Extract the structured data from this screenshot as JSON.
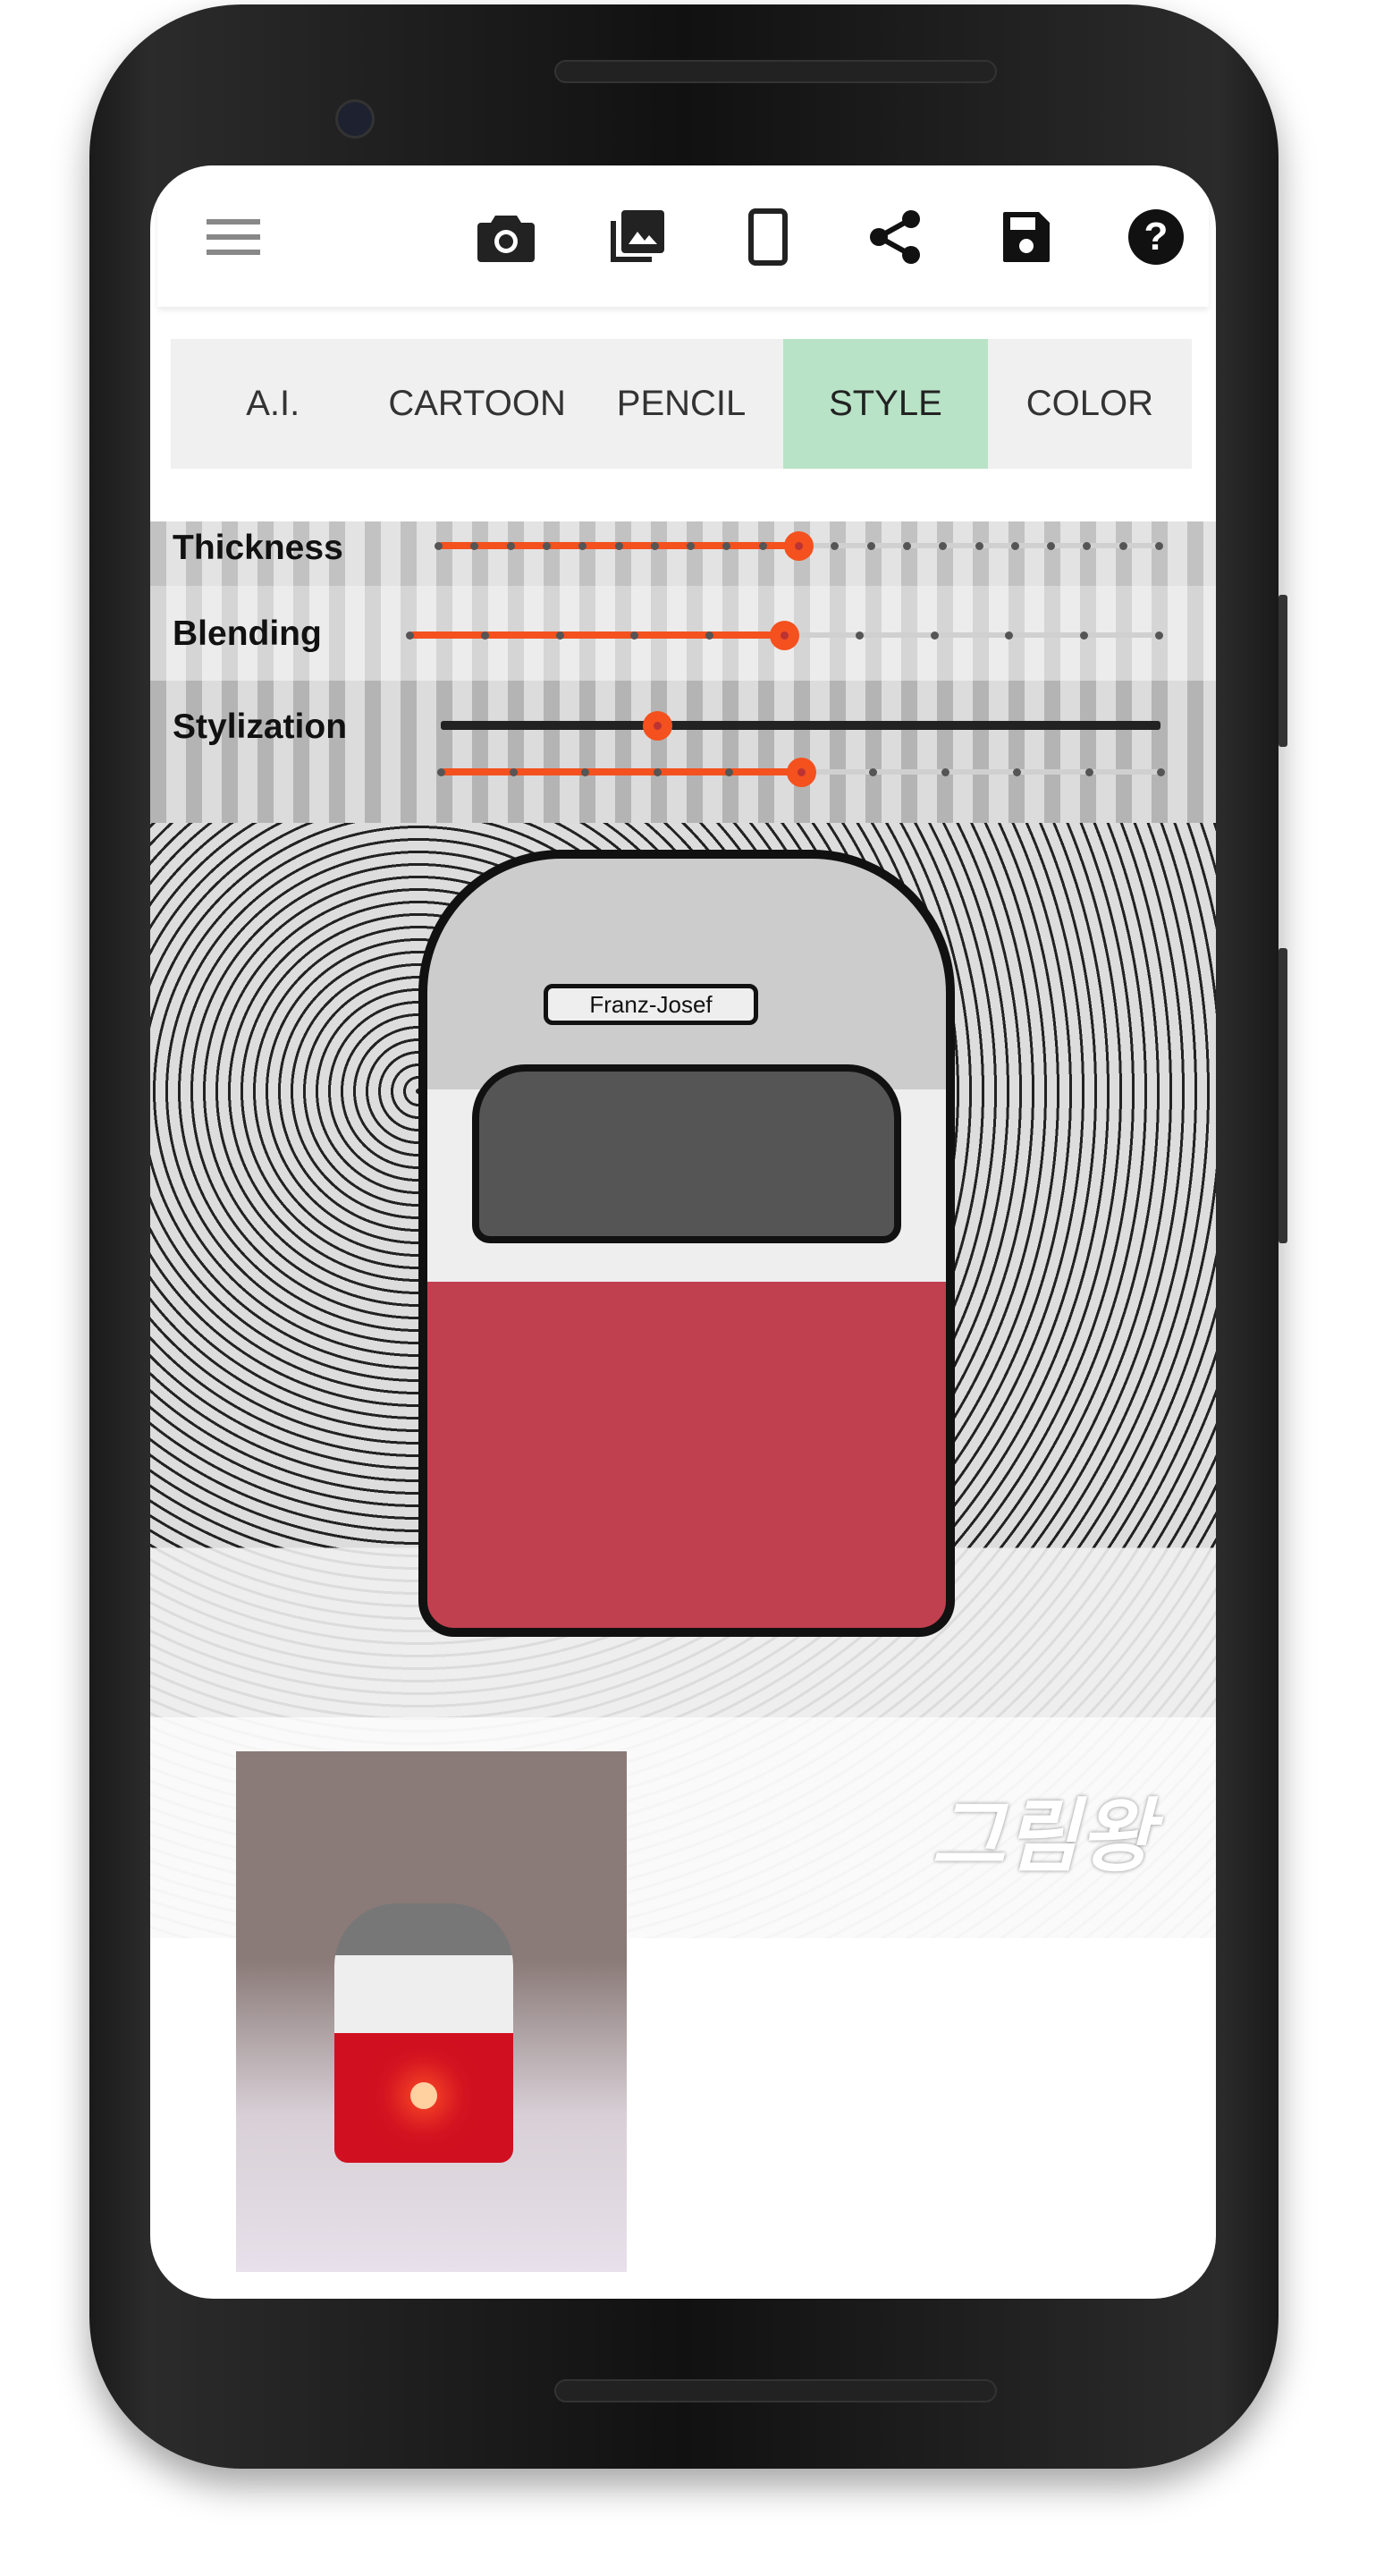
{
  "toolbar": {
    "icons": [
      "menu-icon",
      "camera-icon",
      "gallery-icon",
      "phone-portrait-icon",
      "share-icon",
      "save-icon",
      "help-icon"
    ]
  },
  "tabs": [
    {
      "label": "A.I.",
      "active": false
    },
    {
      "label": "CARTOON",
      "active": false
    },
    {
      "label": "PENCIL",
      "active": false
    },
    {
      "label": "STYLE",
      "active": true
    },
    {
      "label": "COLOR",
      "active": false
    }
  ],
  "controls": {
    "thickness": {
      "label": "Thickness",
      "value": 10,
      "max": 20
    },
    "blending": {
      "label": "Blending",
      "value": 5,
      "max": 10
    },
    "stylization": {
      "label": "Stylization",
      "value": 0.3
    },
    "stylization_steps": {
      "value": 5,
      "max": 10
    }
  },
  "image": {
    "sign_text": "Franz-Josef",
    "watermark": "그림왕"
  },
  "colors": {
    "accent": "#f4511e",
    "active_tab": "#b8e3c6",
    "tab_bar": "#f0f0f0"
  }
}
